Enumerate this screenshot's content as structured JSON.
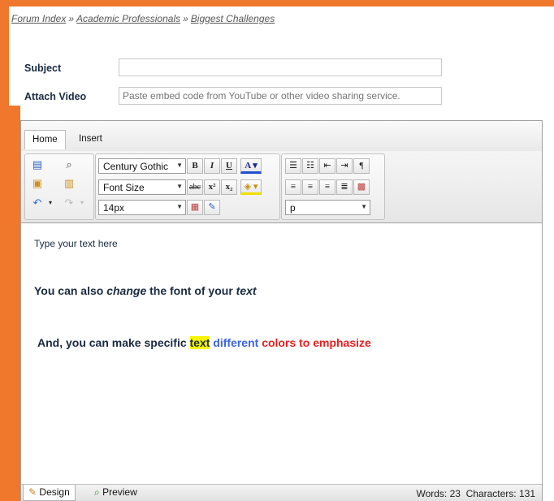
{
  "breadcrumb": [
    "Forum Index",
    "Academic Professionals",
    "Biggest Challenges"
  ],
  "breadcrumb_sep": "»",
  "form": {
    "subject_label": "Subject",
    "subject_value": "",
    "video_label": "Attach Video",
    "video_placeholder": "Paste embed code from YouTube or other video sharing service."
  },
  "editor": {
    "tabs": [
      "Home",
      "Insert"
    ],
    "active_tab": "Home",
    "font_family": "Century Gothic",
    "font_size_label": "Font Size",
    "size_value": "14px",
    "paragraph_value": "p",
    "content": {
      "line1": "Type your text here",
      "line2_a": "You can also ",
      "line2_b": "change",
      "line2_c": " the font of your ",
      "line2_d": "text",
      "line3_a": "And, you can make specific ",
      "line3_hl": "text",
      "line3_blue": " different",
      "line3_red": " colors to emphasize"
    },
    "status": {
      "design_label": "Design",
      "preview_label": "Preview",
      "words_label": "Words: 23",
      "chars_label": "Characters: 131"
    }
  },
  "colors": {
    "accent": "#f0782d",
    "highlight": "#f7f500",
    "blue_text": "#3b64e0",
    "red_text": "#e82020"
  }
}
